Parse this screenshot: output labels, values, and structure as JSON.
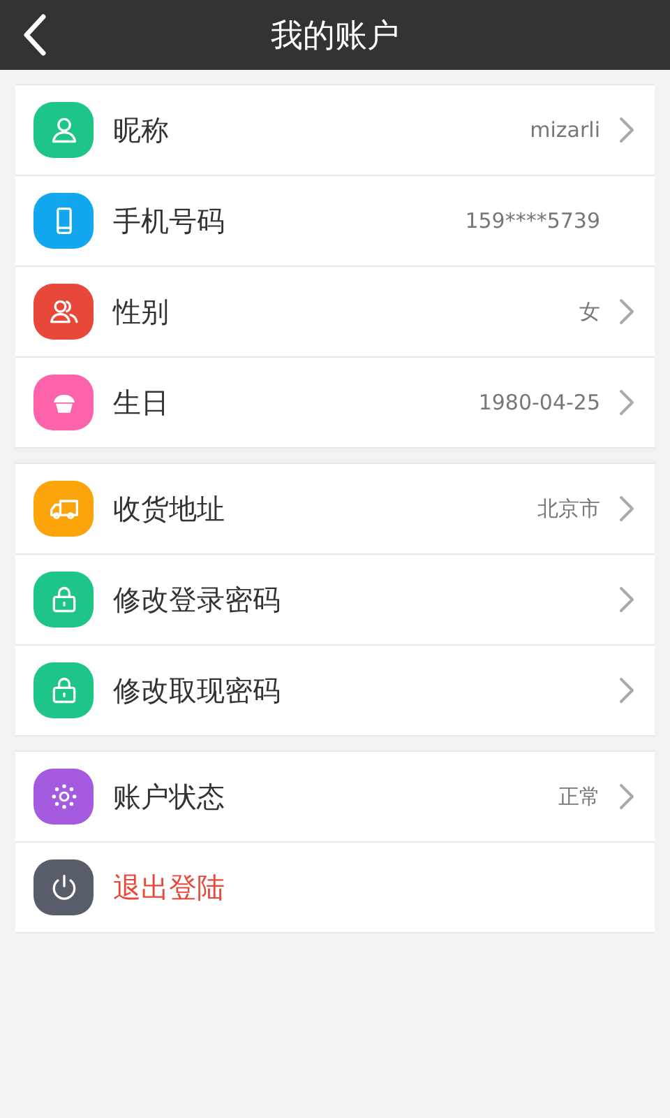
{
  "header": {
    "title": "我的账户"
  },
  "groups": [
    {
      "items": [
        {
          "label": "昵称",
          "value": "mizarli",
          "color": "#1dc686",
          "chevron": true,
          "destructive": false
        },
        {
          "label": "手机号码",
          "value": "159****5739",
          "color": "#12a7ee",
          "chevron": false,
          "destructive": false
        },
        {
          "label": "性别",
          "value": "女",
          "color": "#e8483a",
          "chevron": true,
          "destructive": false
        },
        {
          "label": "生日",
          "value": "1980-04-25",
          "color": "#fd63aa",
          "chevron": true,
          "destructive": false
        }
      ]
    },
    {
      "items": [
        {
          "label": "收货地址",
          "value": "北京市",
          "color": "#fda40b",
          "chevron": true,
          "destructive": false
        },
        {
          "label": "修改登录密码",
          "color": "#1dc686",
          "chevron": true,
          "destructive": false
        },
        {
          "label": "修改取现密码",
          "color": "#1dc686",
          "chevron": true,
          "destructive": false
        }
      ]
    },
    {
      "items": [
        {
          "label": "账户状态",
          "value": "正常",
          "color": "#a55be0",
          "chevron": true,
          "destructive": false
        },
        {
          "label": "退出登陆",
          "color": "#585d6a",
          "chevron": false,
          "destructive": true
        }
      ]
    }
  ]
}
